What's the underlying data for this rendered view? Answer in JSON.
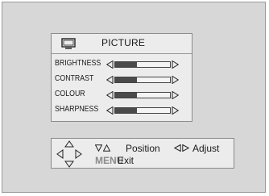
{
  "menu": {
    "title": "PICTURE",
    "icon": "tv-icon",
    "items": [
      {
        "label": "BRIGHTNESS",
        "level": 0.4
      },
      {
        "label": "CONTRAST",
        "level": 0.4
      },
      {
        "label": "COLOUR",
        "level": 0.4
      },
      {
        "label": "SHARPNESS",
        "level": 0.4
      }
    ]
  },
  "help": {
    "position_label": "Position",
    "adjust_label": "Adjust",
    "menu_key": "MENU",
    "exit_label": "Exit"
  },
  "colors": {
    "screen_bg": "#d7d7d7",
    "panel_bg": "#ececec",
    "bar_fill": "#4a4a4a",
    "menu_key": "#8a8a8a"
  }
}
